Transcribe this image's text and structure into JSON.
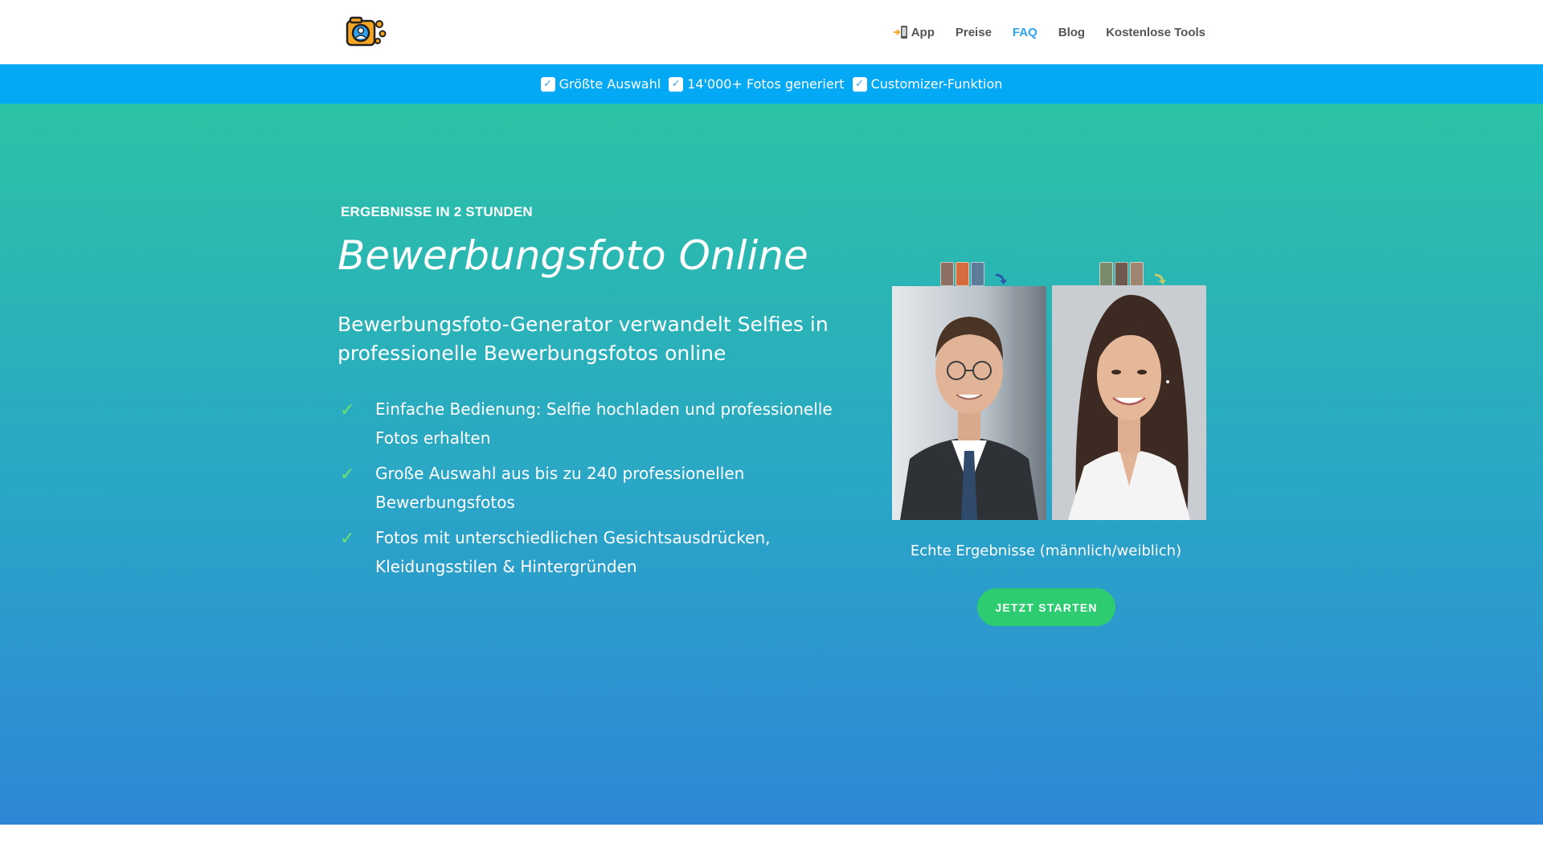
{
  "header": {
    "logo_icon": "camera-user-logo-icon",
    "nav": [
      {
        "label": "App",
        "icon": "phone-icon",
        "active": false
      },
      {
        "label": "Preise",
        "active": false
      },
      {
        "label": "FAQ",
        "active": true
      },
      {
        "label": "Blog",
        "active": false
      },
      {
        "label": "Kostenlose Tools",
        "active": false
      }
    ]
  },
  "ticker": {
    "items": [
      "Größte Auswahl",
      "14'000+ Fotos generiert",
      "Customizer-Funktion"
    ],
    "check_icon": "check-box-icon"
  },
  "hero": {
    "eyebrow": "ERGEBNISSE IN 2 STUNDEN",
    "title": "Bewerbungsfoto Online",
    "subtitle": "Bewerbungsfoto-Generator verwandelt Selfies in professionelle Bewerbungsfotos online",
    "features": [
      "Einfache Bedienung: Selfie hochladen und professionelle Fotos erhalten",
      "Große Auswahl aus bis zu 240 professionellen Bewerbungsfotos",
      "Fotos mit unterschiedlichen Gesichtsausdrücken, Kleidungsstilen & Hintergründen"
    ],
    "caption": "Echte Ergebnisse (männlich/weiblich)",
    "cta_label": "JETZT STARTEN"
  },
  "colors": {
    "brand_blue": "#03a9f4",
    "nav_active": "#2ea3f2",
    "cta_green": "#2ecc71",
    "check_green": "#6ee36a",
    "hero_top": "#2bc3a5",
    "hero_bottom": "#2d87d6"
  }
}
